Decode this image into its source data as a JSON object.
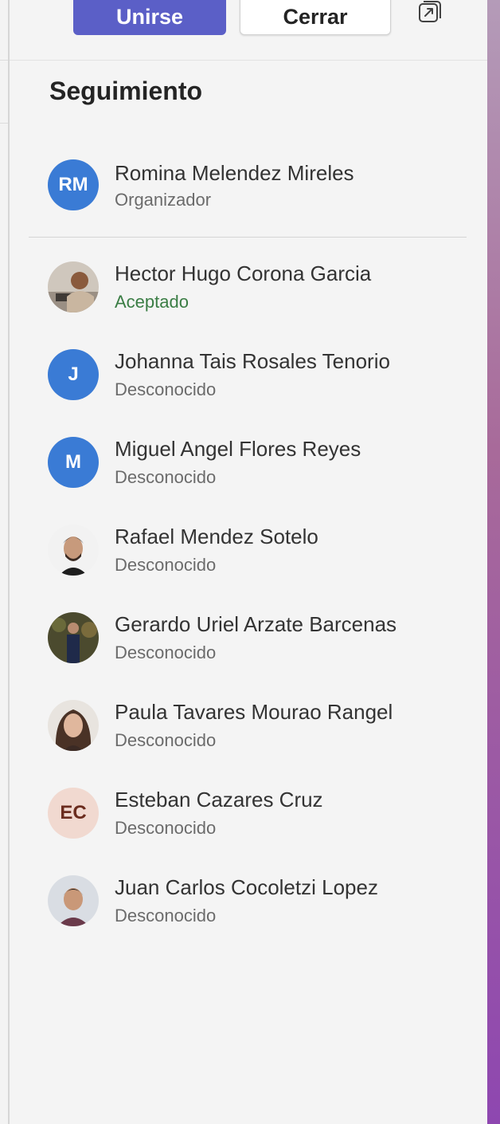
{
  "toolbar": {
    "join_label": "Unirse",
    "close_label": "Cerrar",
    "popout_icon": "popout-icon"
  },
  "section": {
    "title": "Seguimiento"
  },
  "organizer": {
    "name": "Romina Melendez Mireles",
    "role": "Organizador",
    "initials": "RM"
  },
  "attendees": [
    {
      "name": "Hector Hugo Corona Garcia",
      "status": "Aceptado"
    },
    {
      "name": "Johanna Tais Rosales Tenorio",
      "status": "Desconocido",
      "initials": "J"
    },
    {
      "name": "Miguel Angel Flores Reyes",
      "status": "Desconocido",
      "initials": "M"
    },
    {
      "name": "Rafael Mendez Sotelo",
      "status": "Desconocido"
    },
    {
      "name": "Gerardo Uriel Arzate Barcenas",
      "status": "Desconocido"
    },
    {
      "name": "Paula Tavares Mourao Rangel",
      "status": "Desconocido"
    },
    {
      "name": "Esteban Cazares Cruz",
      "status": "Desconocido",
      "initials": "EC"
    },
    {
      "name": "Juan Carlos Cocoletzi Lopez",
      "status": "Desconocido"
    }
  ],
  "colors": {
    "primary_button": "#5b5fc7",
    "avatar_blue": "#3a7bd5",
    "accepted_green": "#3a7d44",
    "peach_avatar": "#f1d9d0"
  }
}
